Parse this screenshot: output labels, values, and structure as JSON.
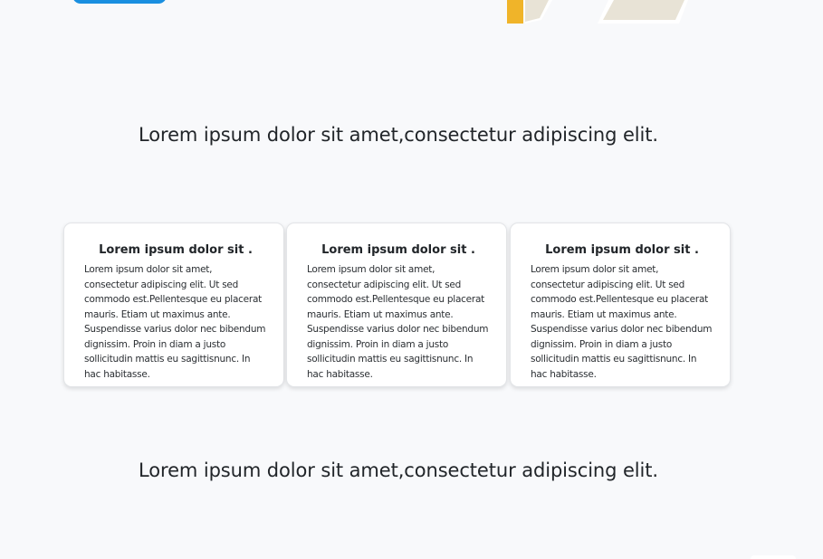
{
  "sections": {
    "heading_top": "Lorem ipsum dolor sit amet,consectetur adipiscing elit.",
    "heading_bottom": "Lorem ipsum dolor sit amet,consectetur adipiscing elit."
  },
  "cards": [
    {
      "title": "Lorem ipsum dolor sit .",
      "body": "Lorem ipsum dolor sit amet, consectetur adipiscing elit. Ut sed commodo est.Pellentesque eu placerat mauris. Etiam ut maximus ante. Suspendisse varius dolor nec bibendum dignissim. Proin in diam a justo sollicitudin mattis eu sagittisnunc. In hac habitasse."
    },
    {
      "title": "Lorem ipsum dolor sit .",
      "body": "Lorem ipsum dolor sit amet, consectetur adipiscing elit. Ut sed commodo est.Pellentesque eu placerat mauris. Etiam ut maximus ante. Suspendisse varius dolor nec bibendum dignissim. Proin in diam a justo sollicitudin mattis eu sagittisnunc. In hac habitasse."
    },
    {
      "title": "Lorem ipsum dolor sit .",
      "body": "Lorem ipsum dolor sit amet, consectetur adipiscing elit. Ut sed commodo est.Pellentesque eu placerat mauris. Etiam ut maximus ante. Suspendisse varius dolor nec bibendum dignissim. Proin in diam a justo sollicitudin mattis eu sagittisnunc. In hac habitasse."
    }
  ],
  "colors": {
    "background": "#f8f9fb",
    "accent_button": "#1a8fe0",
    "illustration_yellow": "#f0b429",
    "illustration_beige": "#e8e3d6"
  },
  "icons": {
    "illustration": "book-illustration"
  }
}
